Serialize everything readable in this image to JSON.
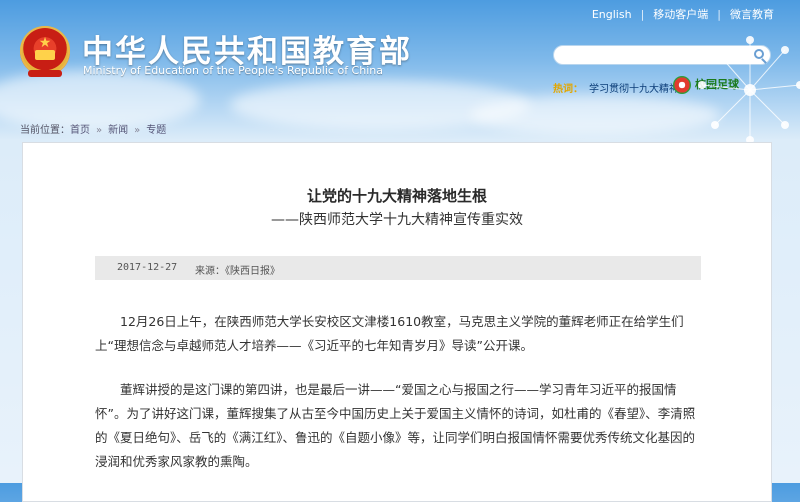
{
  "header": {
    "title": "中华人民共和国教育部",
    "subtitle": "Ministry of Education of the People's Republic of China",
    "toplinks": [
      "English",
      "移动客户端",
      "微言教育"
    ],
    "search": {
      "value": "",
      "placeholder": ""
    },
    "hot": {
      "label": "热词：",
      "text": "学习贯彻十九大精神"
    },
    "football": "校园足球"
  },
  "breadcrumb": {
    "label": "当前位置：",
    "items": [
      "首页",
      "新闻",
      "专题"
    ],
    "separator": "»"
  },
  "article": {
    "title": "让党的十九大精神落地生根",
    "subtitle": "——陕西师范大学十九大精神宣传重实效",
    "date": "2017-12-27",
    "source": "来源：《陕西日报》",
    "paragraphs": [
      "12月26日上午，在陕西师范大学长安校区文津楼1610教室，马克思主义学院的董辉老师正在给学生们上“理想信念与卓越师范人才培养——《习近平的七年知青岁月》导读”公开课。",
      "董辉讲授的是这门课的第四讲，也是最后一讲——“爱国之心与报国之行——学习青年习近平的报国情怀”。为了讲好这门课，董辉搜集了从古至今中国历史上关于爱国主义情怀的诗词，如杜甫的《春望》、李清照的《夏日绝句》、岳飞的《满江红》、鲁迅的《自题小像》等，让同学们明白报国情怀需要优秀传统文化基因的浸润和优秀家风家教的熏陶。"
    ]
  },
  "icons": [
    "national-emblem-icon",
    "search-icon",
    "football-icon",
    "dandelion-decoration-icon"
  ]
}
